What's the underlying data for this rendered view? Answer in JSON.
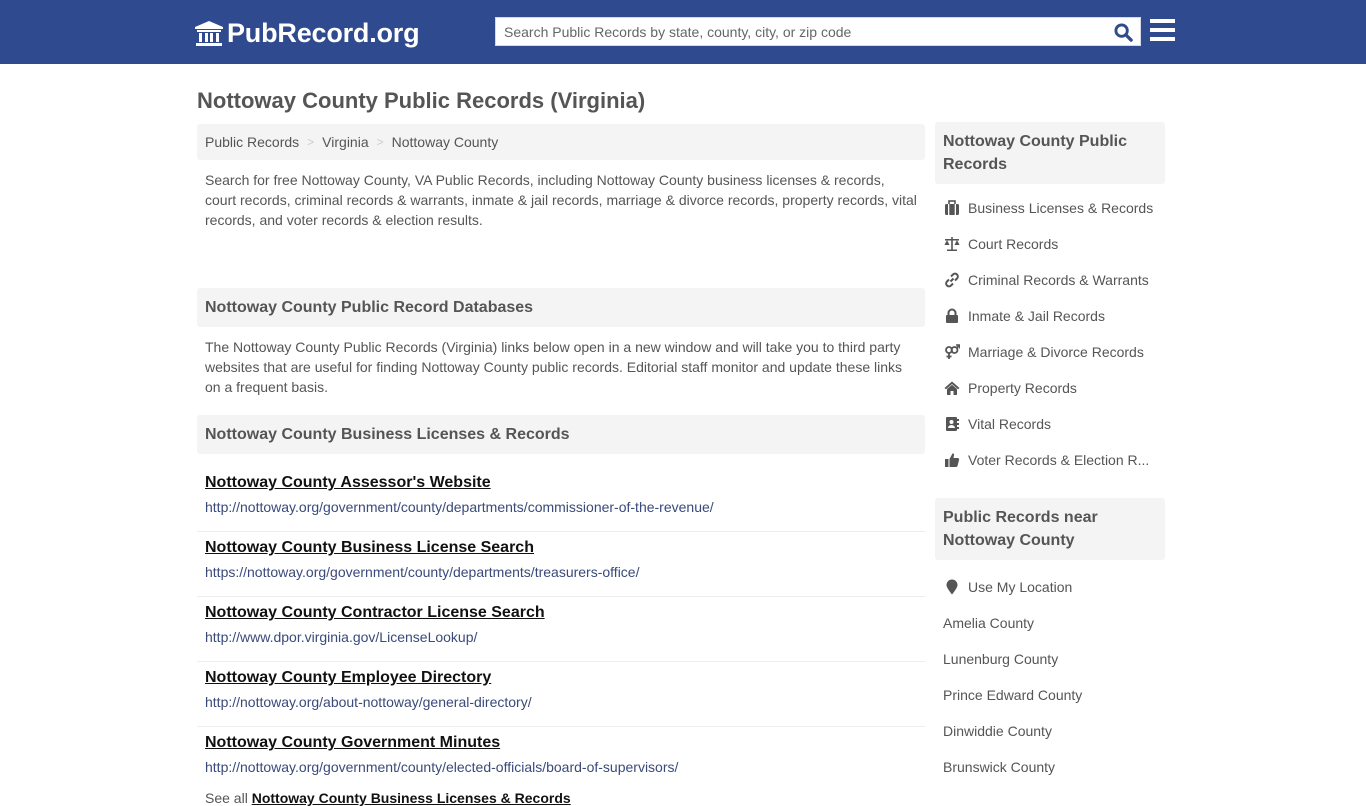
{
  "header": {
    "logo_text": "PubRecord.org",
    "search_placeholder": "Search Public Records by state, county, city, or zip code",
    "brand_color": "#2f4a8e"
  },
  "page": {
    "title": "Nottoway County Public Records (Virginia)"
  },
  "breadcrumb": [
    {
      "label": "Public Records"
    },
    {
      "label": "Virginia"
    },
    {
      "label": "Nottoway County"
    }
  ],
  "breadcrumb_sep": ">",
  "intro": "Search for free Nottoway County, VA Public Records, including Nottoway County business licenses & records, court records, criminal records & warrants, inmate & jail records, marriage & divorce records, property records, vital records, and voter records & election results.",
  "databases": {
    "heading": "Nottoway County Public Record Databases",
    "description": "The Nottoway County Public Records (Virginia) links below open in a new window and will take you to third party websites that are useful for finding Nottoway County public records. Editorial staff monitor and update these links on a frequent basis."
  },
  "business_section": {
    "heading": "Nottoway County Business Licenses & Records",
    "links": [
      {
        "title": "Nottoway County Assessor's Website",
        "url": "http://nottoway.org/government/county/departments/commissioner-of-the-revenue/"
      },
      {
        "title": "Nottoway County Business License Search",
        "url": "https://nottoway.org/government/county/departments/treasurers-office/"
      },
      {
        "title": "Nottoway County Contractor License Search",
        "url": "http://www.dpor.virginia.gov/LicenseLookup/"
      },
      {
        "title": "Nottoway County Employee Directory",
        "url": "http://nottoway.org/about-nottoway/general-directory/"
      },
      {
        "title": "Nottoway County Government Minutes",
        "url": "http://nottoway.org/government/county/elected-officials/board-of-supervisors/"
      }
    ],
    "see_all_prefix": "See all",
    "see_all_link": "Nottoway County Business Licenses & Records"
  },
  "sidebar": {
    "records_heading": "Nottoway County Public Records",
    "records": [
      {
        "label": "Business Licenses & Records",
        "icon": "briefcase-icon"
      },
      {
        "label": "Court Records",
        "icon": "balance-scale-icon"
      },
      {
        "label": "Criminal Records & Warrants",
        "icon": "link-icon"
      },
      {
        "label": "Inmate & Jail Records",
        "icon": "lock-icon"
      },
      {
        "label": "Marriage & Divorce Records",
        "icon": "venus-mars-icon"
      },
      {
        "label": "Property Records",
        "icon": "home-icon"
      },
      {
        "label": "Vital Records",
        "icon": "address-book-icon"
      },
      {
        "label": "Voter Records & Election R...",
        "icon": "thumbs-up-icon"
      }
    ],
    "nearby_heading": "Public Records near Nottoway County",
    "use_location": "Use My Location",
    "nearby": [
      {
        "label": "Amelia County"
      },
      {
        "label": "Lunenburg County"
      },
      {
        "label": "Prince Edward County"
      },
      {
        "label": "Dinwiddie County"
      },
      {
        "label": "Brunswick County"
      }
    ]
  }
}
